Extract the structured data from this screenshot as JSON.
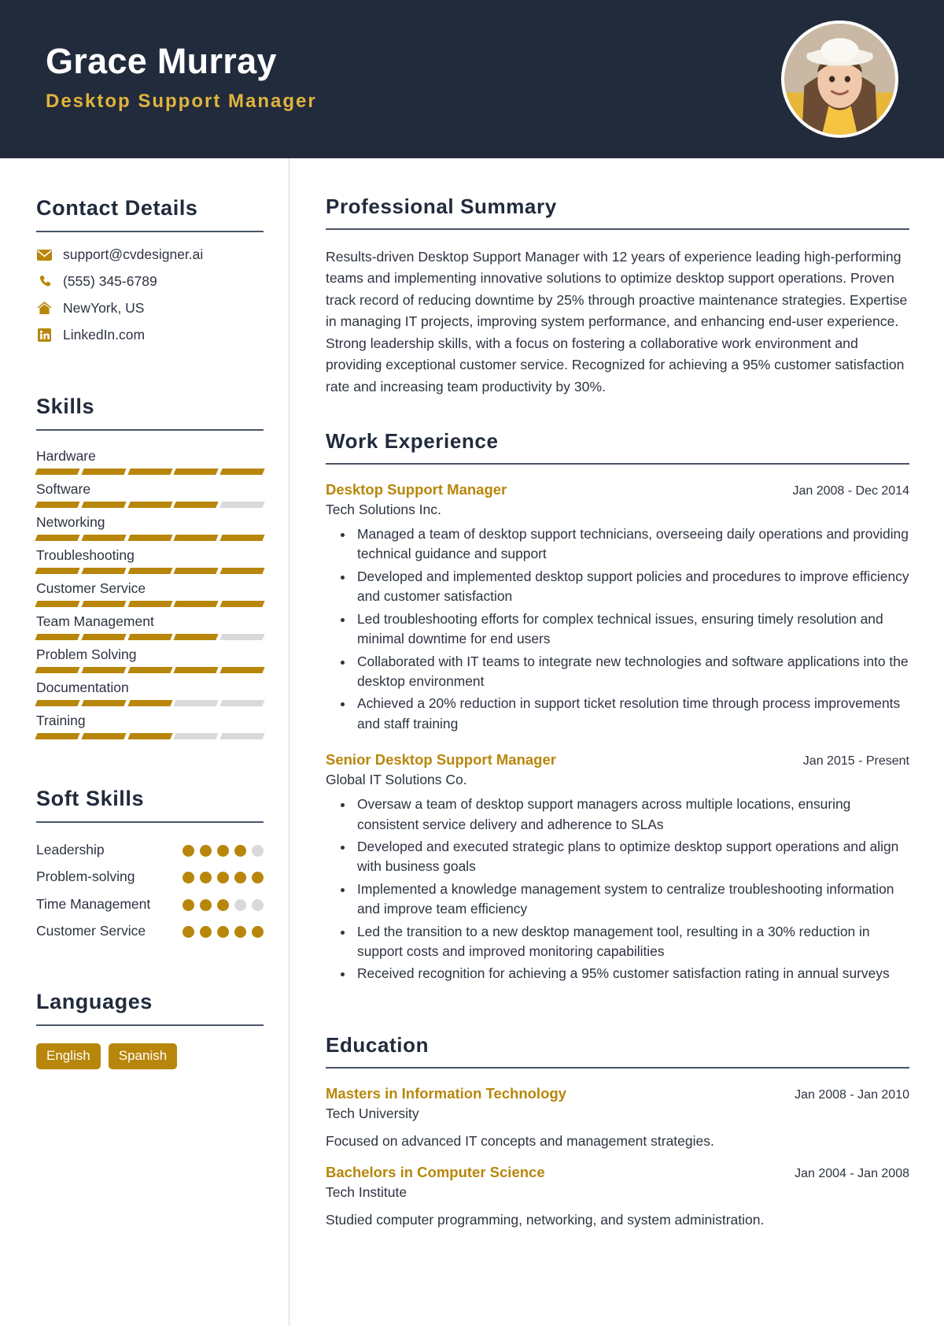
{
  "theme": {
    "header_bg": "#222b3c",
    "accent_gold": "#b8860b",
    "title_gold": "#e0b43c",
    "text_dark": "#2d3340",
    "rule": "#4a5568",
    "empty_bar": "#d9d9d9"
  },
  "header": {
    "name": "Grace Murray",
    "title": "Desktop Support Manager",
    "avatar_alt": "profile-photo"
  },
  "sidebar": {
    "contact": {
      "heading": "Contact Details",
      "items": [
        {
          "icon": "envelope-icon",
          "value": "support@cvdesigner.ai"
        },
        {
          "icon": "phone-icon",
          "value": "(555) 345-6789"
        },
        {
          "icon": "home-icon",
          "value": "NewYork, US"
        },
        {
          "icon": "linkedin-icon",
          "value": "LinkedIn.com"
        }
      ]
    },
    "skills": {
      "heading": "Skills",
      "max": 5,
      "items": [
        {
          "label": "Hardware",
          "level": 5
        },
        {
          "label": "Software",
          "level": 4
        },
        {
          "label": "Networking",
          "level": 5
        },
        {
          "label": "Troubleshooting",
          "level": 5
        },
        {
          "label": "Customer Service",
          "level": 5
        },
        {
          "label": "Team Management",
          "level": 4
        },
        {
          "label": "Problem Solving",
          "level": 5
        },
        {
          "label": "Documentation",
          "level": 3
        },
        {
          "label": "Training",
          "level": 3
        }
      ]
    },
    "soft_skills": {
      "heading": "Soft Skills",
      "max": 5,
      "items": [
        {
          "label": "Leadership",
          "level": 4
        },
        {
          "label": "Problem-solving",
          "level": 5
        },
        {
          "label": "Time Management",
          "level": 3
        },
        {
          "label": "Customer Service",
          "level": 5
        }
      ]
    },
    "languages": {
      "heading": "Languages",
      "items": [
        "English",
        "Spanish"
      ]
    }
  },
  "main": {
    "summary": {
      "heading": "Professional Summary",
      "text": "Results-driven Desktop Support Manager with 12 years of experience leading high-performing teams and implementing innovative solutions to optimize desktop support operations. Proven track record of reducing downtime by 25% through proactive maintenance strategies. Expertise in managing IT projects, improving system performance, and enhancing end-user experience. Strong leadership skills, with a focus on fostering a collaborative work environment and providing exceptional customer service. Recognized for achieving a 95% customer satisfaction rate and increasing team productivity by 30%."
    },
    "work": {
      "heading": "Work Experience",
      "entries": [
        {
          "title": "Desktop Support Manager",
          "company": "Tech Solutions Inc.",
          "date": "Jan 2008 - Dec 2014",
          "bullets": [
            "Managed a team of desktop support technicians, overseeing daily operations and providing technical guidance and support",
            "Developed and implemented desktop support policies and procedures to improve efficiency and customer satisfaction",
            "Led troubleshooting efforts for complex technical issues, ensuring timely resolution and minimal downtime for end users",
            "Collaborated with IT teams to integrate new technologies and software applications into the desktop environment",
            "Achieved a 20% reduction in support ticket resolution time through process improvements and staff training"
          ]
        },
        {
          "title": "Senior Desktop Support Manager",
          "company": "Global IT Solutions Co.",
          "date": "Jan 2015 - Present",
          "bullets": [
            "Oversaw a team of desktop support managers across multiple locations, ensuring consistent service delivery and adherence to SLAs",
            "Developed and executed strategic plans to optimize desktop support operations and align with business goals",
            "Implemented a knowledge management system to centralize troubleshooting information and improve team efficiency",
            "Led the transition to a new desktop management tool, resulting in a 30% reduction in support costs and improved monitoring capabilities",
            "Received recognition for achieving a 95% customer satisfaction rating in annual surveys"
          ]
        }
      ]
    },
    "education": {
      "heading": "Education",
      "entries": [
        {
          "degree": "Masters in Information Technology",
          "school": "Tech University",
          "date": "Jan 2008 - Jan 2010",
          "description": "Focused on advanced IT concepts and management strategies."
        },
        {
          "degree": "Bachelors in Computer Science",
          "school": "Tech Institute",
          "date": "Jan 2004 - Jan 2008",
          "description": "Studied computer programming, networking, and system administration."
        }
      ]
    }
  }
}
